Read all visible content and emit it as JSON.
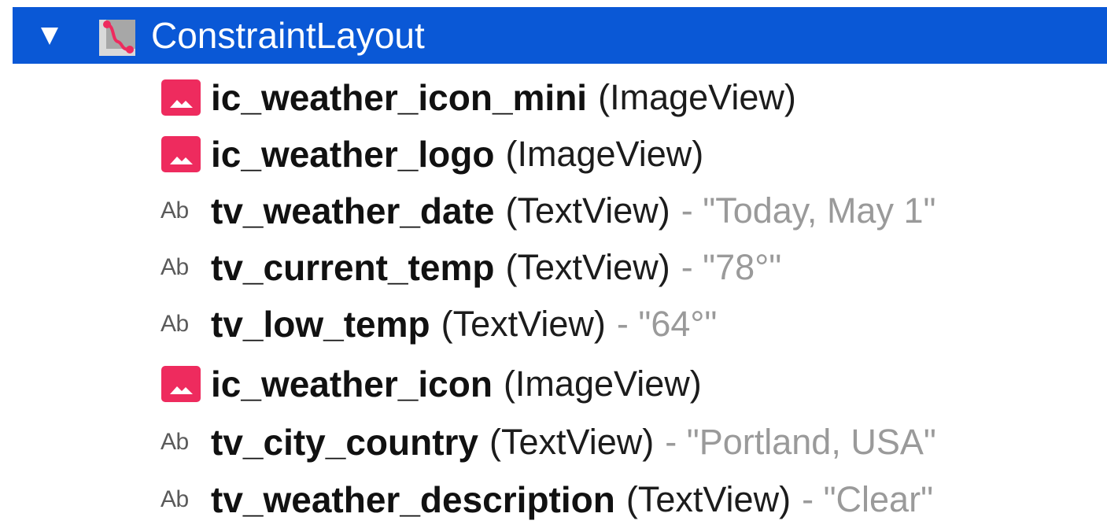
{
  "tree": {
    "root": {
      "label": "ConstraintLayout",
      "expanded": true,
      "selected": true,
      "icon": "constraint-layout-icon"
    },
    "children": [
      {
        "name": "ic_weather_icon_mini",
        "kind": "(ImageView)",
        "value": "",
        "icon": "image-view-icon"
      },
      {
        "name": "ic_weather_logo",
        "kind": "(ImageView)",
        "value": "",
        "icon": "image-view-icon"
      },
      {
        "name": "tv_weather_date",
        "kind": "(TextView)",
        "value": "- \"Today, May 1\"",
        "icon": "text-view-icon"
      },
      {
        "name": "tv_current_temp",
        "kind": "(TextView)",
        "value": "- \"78°\"",
        "icon": "text-view-icon"
      },
      {
        "name": "tv_low_temp",
        "kind": "(TextView)",
        "value": "- \"64°\"",
        "icon": "text-view-icon"
      },
      {
        "name": "ic_weather_icon",
        "kind": "(ImageView)",
        "value": "",
        "icon": "image-view-icon"
      },
      {
        "name": "tv_city_country",
        "kind": "(TextView)",
        "value": "- \"Portland, USA\"",
        "icon": "text-view-icon"
      },
      {
        "name": "tv_weather_description",
        "kind": "(TextView)",
        "value": "- \"Clear\"",
        "icon": "text-view-icon"
      }
    ],
    "text_icon_glyph": "Ab"
  },
  "colors": {
    "selection": "#0a58d6",
    "image_icon": "#ee2b5e",
    "value_text": "#9a9a9a"
  }
}
